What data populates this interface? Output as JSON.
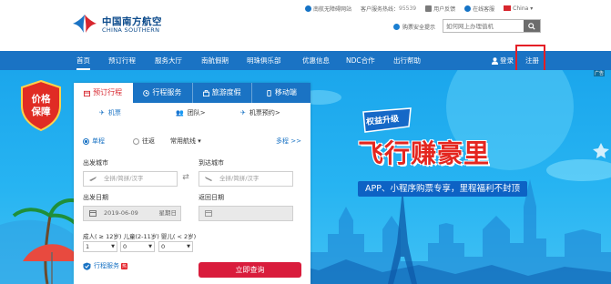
{
  "brand": {
    "name_cn": "中国南方航空",
    "name_en": "CHINA SOUTHERN",
    "primary_color": "#1a73c4",
    "accent_color": "#d7262e"
  },
  "toplinks": {
    "barrier_free": "南航无障碍网站",
    "hotline_label": "客户服务热线：",
    "hotline_number": "95539",
    "feedback": "用户反馈",
    "online_service": "在线客服",
    "country": "China"
  },
  "header": {
    "safety_notice": "购票安全提示",
    "search_placeholder": "如何网上办理值机"
  },
  "nav": {
    "items": [
      {
        "label": "首页"
      },
      {
        "label": "预订行程"
      },
      {
        "label": "服务大厅"
      },
      {
        "label": "南航假期"
      },
      {
        "label": "明珠俱乐部"
      },
      {
        "label": "优惠信息"
      },
      {
        "label": "NDC合作"
      },
      {
        "label": "出行帮助"
      }
    ],
    "login": "登录",
    "register": "注册",
    "ad": "广告"
  },
  "banner": {
    "badge_line1": "价格",
    "badge_line2": "保障",
    "promo_badge": "权益升级",
    "promo_title": "飞行赚豪里",
    "promo_sub": "APP、小程序购票专享，里程福利不封顶"
  },
  "booking": {
    "tabs": [
      {
        "label": "预订行程"
      },
      {
        "label": "行程服务"
      },
      {
        "label": "旅游度假"
      },
      {
        "label": "移动端"
      }
    ],
    "subtabs": [
      {
        "label": "机票"
      },
      {
        "label": "团队>"
      },
      {
        "label": "机票预约>"
      }
    ],
    "trip_one_way": "单程",
    "trip_round": "往返",
    "airline_select": "常用航线",
    "multi_city": "多程 >>",
    "from_label": "出发城市",
    "to_label": "到达城市",
    "city_placeholder": "全拼/简拼/汉字",
    "depart_label": "出发日期",
    "return_label": "返回日期",
    "depart_date": "2019-06-09",
    "depart_weekday": "星期日",
    "pax_label": "成人( ≥ 12岁)   儿童(2-11岁)   婴儿( < 2岁)",
    "adults": "1",
    "children": "0",
    "infants": "0",
    "trip_service": "行程服务",
    "hot_tag": "热",
    "search_button": "立即查询"
  }
}
